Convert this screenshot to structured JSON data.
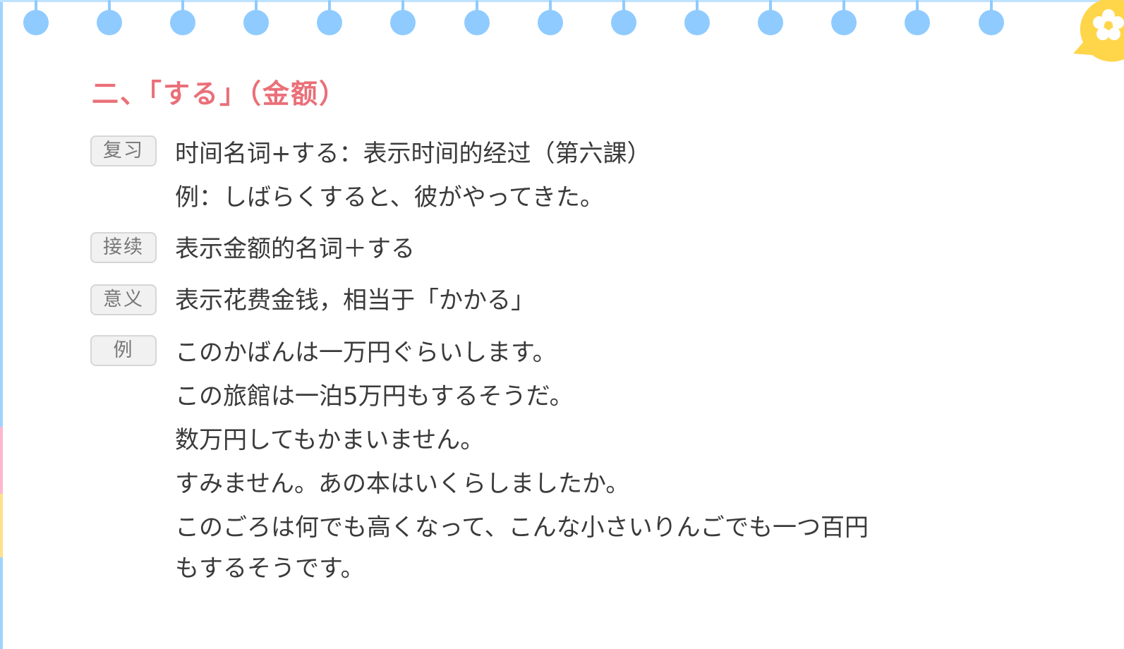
{
  "title": "二、「する」（金额）",
  "sections": {
    "review": {
      "tag": "复习",
      "lines": [
        "时间名词+する：表示时间的经过（第六課）",
        "例：しばらくすると、彼がやってきた。"
      ]
    },
    "connection": {
      "tag": "接续",
      "lines": [
        "表示金额的名词＋する"
      ]
    },
    "meaning": {
      "tag": "意义",
      "lines": [
        "表示花费金钱，相当于「かかる」"
      ]
    },
    "examples": {
      "tag": "例",
      "lines": [
        "このかばんは一万円ぐらいします。",
        "この旅館は一泊5万円もするそうだ。",
        "数万円してもかまいません。",
        "すみません。あの本はいくらしましたか。",
        "このごろは何でも高くなって、こんな小さいりんごでも一つ百円",
        "もするそうです。"
      ]
    }
  },
  "colors": {
    "title": "#ea6f78",
    "ring": "#8fcbff",
    "tag_bg": "#f1f1f1",
    "tag_border": "#d6d6d6",
    "badge": "#ffd54a",
    "text": "#3a3a3a"
  },
  "icons": {
    "ring": "binder-ring-icon",
    "badge": "flower-badge-icon"
  }
}
